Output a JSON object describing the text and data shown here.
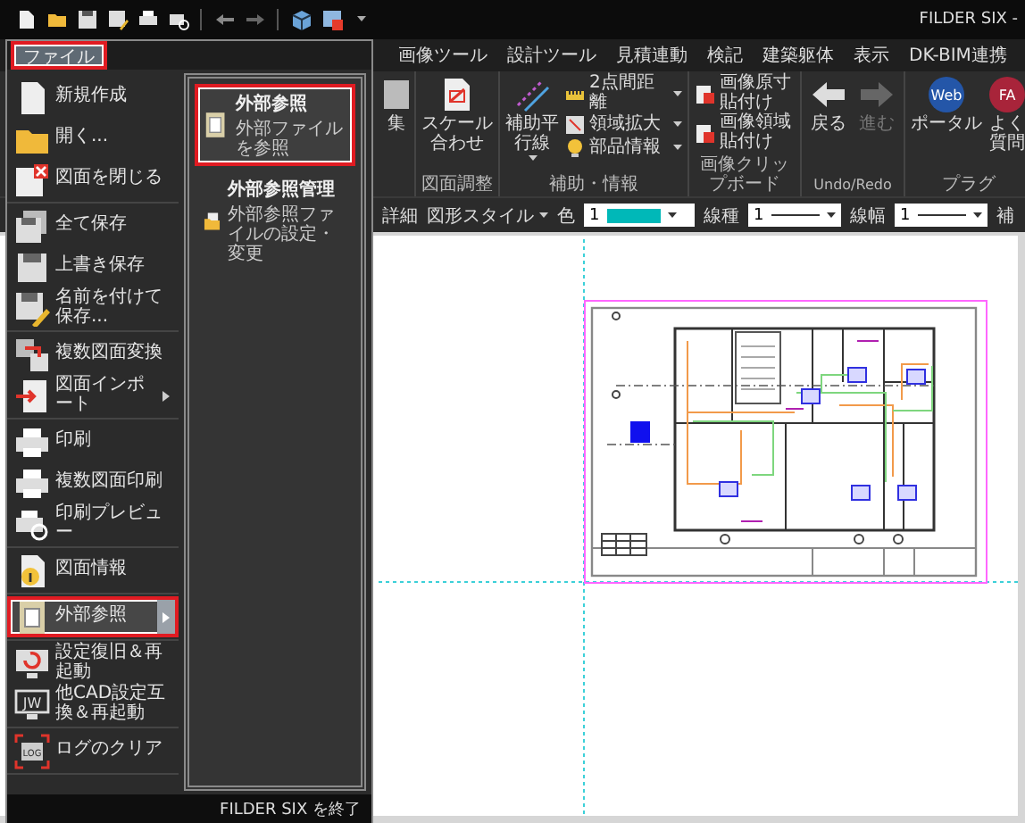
{
  "title_bar": {
    "title": "FILDER SIX -"
  },
  "file_tab": {
    "label": "ファイル",
    "open": true
  },
  "ribbon": {
    "tabs": [
      "画像ツール",
      "設計ツール",
      "見積連動",
      "検記",
      "建築躯体",
      "表示",
      "DK-BIM連携"
    ],
    "groups": [
      {
        "items": [
          {
            "kind": "large",
            "label": "集"
          }
        ]
      },
      {
        "label": "図面調整",
        "items": [
          {
            "kind": "large",
            "label": "スケール合わせ"
          }
        ]
      },
      {
        "label": "補助・情報",
        "items": [
          {
            "kind": "large",
            "label": "補助平行線",
            "dropdown": true
          },
          {
            "kind": "small",
            "label": "2点間距離",
            "dropdown": true
          },
          {
            "kind": "small",
            "label": "領域拡大",
            "dropdown": true
          },
          {
            "kind": "small",
            "label": "部品情報",
            "dropdown": true
          }
        ]
      },
      {
        "label": "画像クリップボード",
        "items": [
          {
            "kind": "small",
            "label": "画像原寸貼付け"
          },
          {
            "kind": "small",
            "label": "画像領域貼付け"
          }
        ]
      },
      {
        "label": "Undo/Redo",
        "items": [
          {
            "kind": "large",
            "label": "戻る",
            "disabled": false
          },
          {
            "kind": "large",
            "label": "進む",
            "disabled": true
          }
        ]
      },
      {
        "label": "プラグ",
        "items": [
          {
            "kind": "large",
            "label": "ポータル",
            "icon_text": "Web"
          },
          {
            "kind": "large",
            "label": "よく質問",
            "icon_text": "FA"
          }
        ]
      }
    ]
  },
  "property_bar": {
    "items": [
      {
        "kind": "label",
        "text": "詳細"
      },
      {
        "kind": "menu",
        "text": "図形スタイル"
      },
      {
        "kind": "label",
        "text": "色"
      },
      {
        "kind": "color-select",
        "value": "1",
        "color": "#00b8b8"
      },
      {
        "kind": "label",
        "text": "線種"
      },
      {
        "kind": "line-select",
        "value": "1"
      },
      {
        "kind": "label",
        "text": "線幅"
      },
      {
        "kind": "line-select",
        "value": "1"
      },
      {
        "kind": "label",
        "text": "補"
      }
    ]
  },
  "file_menu": {
    "groups": [
      {
        "items": [
          {
            "label": "新規作成",
            "selected": false,
            "submenu": false
          },
          {
            "label": "開く...",
            "selected": false,
            "submenu": false
          },
          {
            "label": "図面を閉じる",
            "selected": false,
            "submenu": false
          }
        ]
      },
      {
        "items": [
          {
            "label": "全て保存",
            "selected": false,
            "submenu": false
          },
          {
            "label": "上書き保存",
            "selected": false,
            "submenu": false
          },
          {
            "label": "名前を付けて保存...",
            "selected": false,
            "submenu": false
          }
        ]
      },
      {
        "items": [
          {
            "label": "複数図面変換",
            "selected": false,
            "submenu": false
          },
          {
            "label": "図面インポート",
            "selected": false,
            "submenu": true
          }
        ]
      },
      {
        "items": [
          {
            "label": "印刷",
            "selected": false,
            "submenu": false
          },
          {
            "label": "複数図面印刷",
            "selected": false,
            "submenu": false
          },
          {
            "label": "印刷プレビュー",
            "selected": false,
            "submenu": false
          }
        ]
      },
      {
        "items": [
          {
            "label": "図面情報",
            "selected": false,
            "submenu": false
          }
        ]
      },
      {
        "items": [
          {
            "label": "外部参照",
            "selected": true,
            "submenu": true
          }
        ]
      },
      {
        "items": [
          {
            "label": "設定復旧＆再起動",
            "selected": false,
            "submenu": false
          },
          {
            "label": "他CAD設定互換＆再起動",
            "selected": false,
            "submenu": false,
            "icon_text": "JW"
          }
        ]
      },
      {
        "items": [
          {
            "label": "ログのクリア",
            "selected": false,
            "submenu": false,
            "icon_text": "LOG"
          }
        ]
      }
    ],
    "submenu": {
      "items": [
        {
          "title": "外部参照",
          "description": "外部ファイルを参照",
          "selected": true
        },
        {
          "title": "外部参照管理",
          "description": "外部参照ファイルの設定・変更",
          "selected": false
        }
      ]
    },
    "exit_label": "FILDER SIX を終了"
  }
}
